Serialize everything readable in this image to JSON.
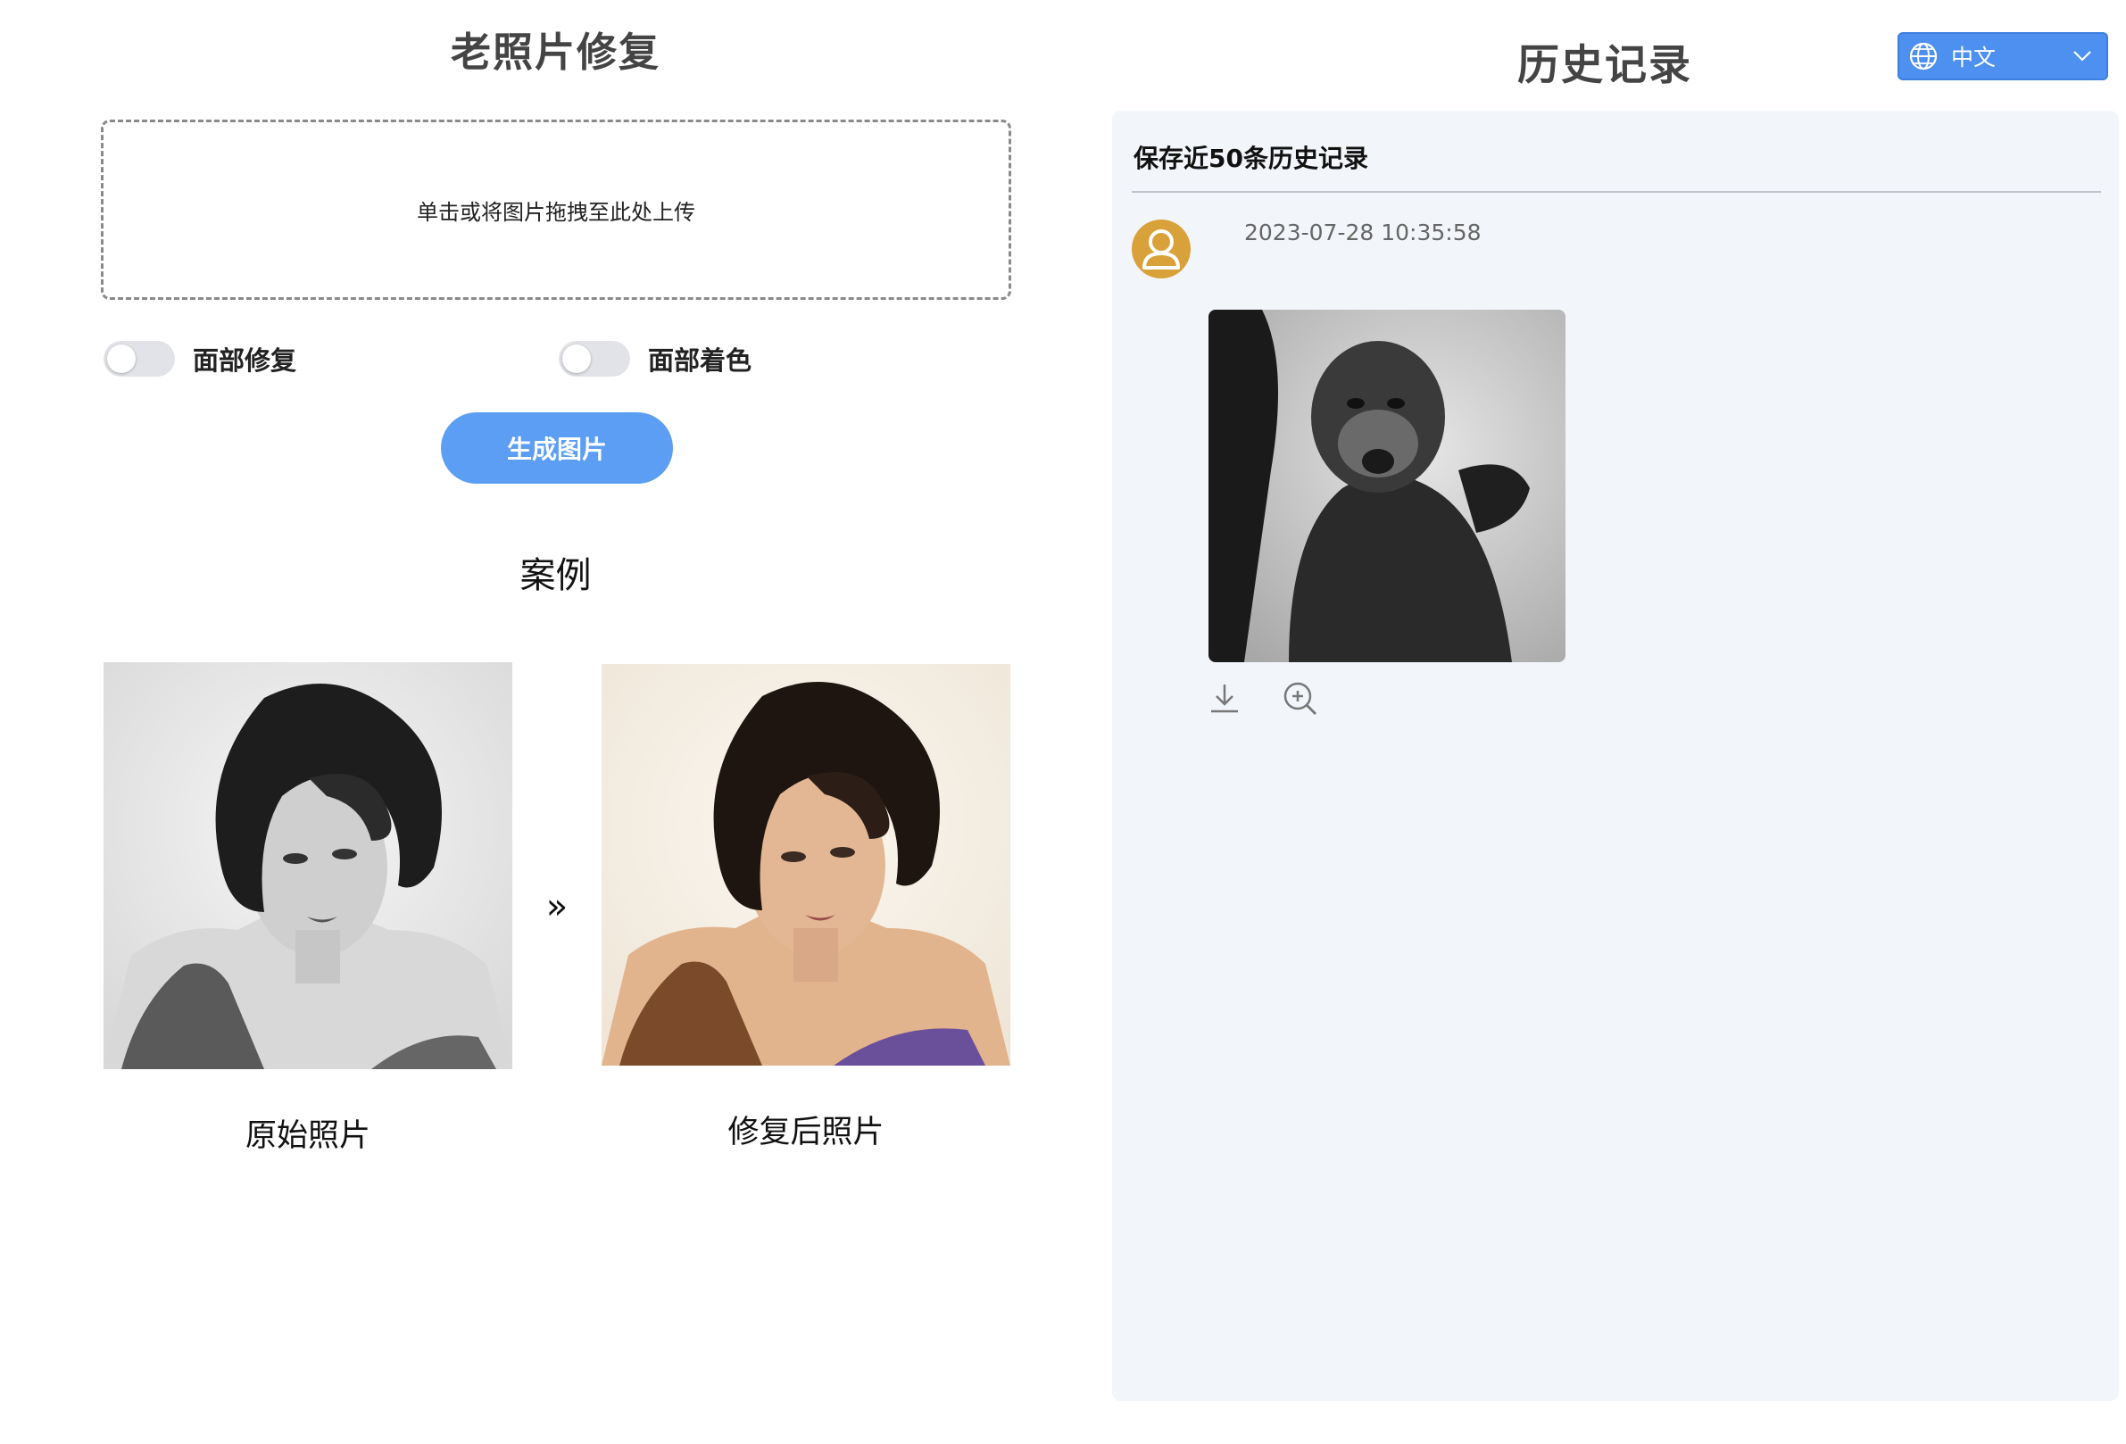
{
  "left": {
    "title": "老照片修复",
    "upload_prompt": "单击或将图片拖拽至此处上传",
    "toggles": [
      {
        "label": "面部修复",
        "on": false
      },
      {
        "label": "面部着色",
        "on": false
      }
    ],
    "generate_button": "生成图片",
    "example_title": "案例",
    "example": {
      "original_caption": "原始照片",
      "restored_caption": "修复后照片",
      "arrow_icon": "double-chevron-right-icon"
    }
  },
  "right": {
    "title": "历史记录",
    "language": {
      "selected": "中文",
      "icon": "globe-icon"
    },
    "history_header": "保存近50条历史记录",
    "entries": [
      {
        "timestamp": "2023-07-28 10:35:58",
        "actions": [
          "download-icon",
          "zoom-in-icon"
        ]
      }
    ]
  },
  "colors": {
    "accent": "#5b9ef4",
    "language_select": "#4d90f0",
    "history_bg": "#f2f5fa",
    "avatar": "#d9a13a"
  }
}
